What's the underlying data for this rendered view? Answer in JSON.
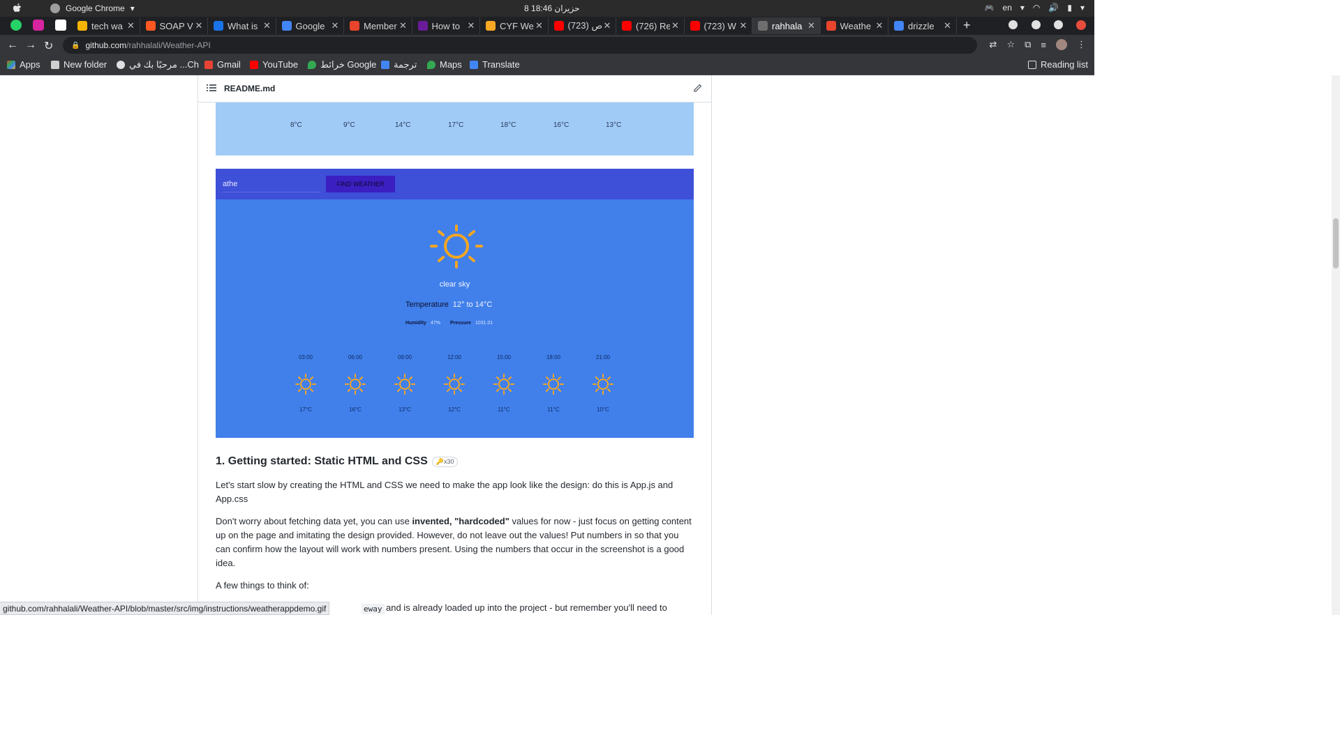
{
  "os_bar": {
    "app_name": "Google Chrome",
    "clock": "8 حزيران 18:46",
    "language": "en"
  },
  "tabs": [
    {
      "label": "tech wa",
      "favicon_color": "#f4b400"
    },
    {
      "label": "SOAP V",
      "favicon_color": "#ff5722"
    },
    {
      "label": "What is",
      "favicon_color": "#1a73e8"
    },
    {
      "label": "Google",
      "favicon_color": "#4285f4"
    },
    {
      "label": "Member",
      "favicon_color": "#e8452c"
    },
    {
      "label": "How to",
      "favicon_color": "#6a1b9a"
    },
    {
      "label": "CYF We",
      "favicon_color": "#f9a825"
    },
    {
      "label": "(723) اص",
      "favicon_color": "#ff0000"
    },
    {
      "label": "(726) Re",
      "favicon_color": "#ff0000"
    },
    {
      "label": "(723) W",
      "favicon_color": "#ff0000"
    },
    {
      "label": "rahhala",
      "favicon_color": "#6e6e6e"
    },
    {
      "label": "Weathe",
      "favicon_color": "#e8452c"
    },
    {
      "label": "drizzle",
      "favicon_color": "#4285f4"
    }
  ],
  "address_bar": {
    "host": "github.com",
    "path": "/rahhalali/Weather-API"
  },
  "bookmarks": [
    {
      "label": "Apps"
    },
    {
      "label": "New folder"
    },
    {
      "label": "مرحبًا بك في ...Ch"
    },
    {
      "label": "Gmail"
    },
    {
      "label": "YouTube"
    },
    {
      "label": "خرائط Google"
    },
    {
      "label": "ترجمة"
    },
    {
      "label": "Maps"
    },
    {
      "label": "Translate"
    }
  ],
  "reading_list": "Reading list",
  "readme": {
    "filename": "README.md"
  },
  "gif_top": {
    "temps": [
      "8°C",
      "9°C",
      "14°C",
      "17°C",
      "18°C",
      "16°C",
      "13°C"
    ]
  },
  "weather_app": {
    "search_value": "athe",
    "find_button": "FIND WEATHER",
    "description": "clear sky",
    "temperature_label": "Temperature",
    "temperature_value": "12° to 14°C",
    "humidity_label": "Humidity",
    "humidity_value": "47%",
    "pressure_label": "Pressure",
    "pressure_value": "1031.01",
    "hours": [
      "03:00",
      "06:00",
      "09:00",
      "12:00",
      "15:00",
      "18:00",
      "21:00"
    ],
    "hour_temps": [
      "17°C",
      "16°C",
      "13°C",
      "12°C",
      "11°C",
      "11°C",
      "10°C"
    ],
    "sun_color": "#f5a623"
  },
  "section": {
    "heading": "1. Getting started: Static HTML and CSS",
    "badge": "🔑x30",
    "p1": "Let's start slow by creating the HTML and CSS we need to make the app look like the design: do this is App.js and App.css",
    "p2_a": "Don't worry about fetching data yet, you can use ",
    "p2_bold": "invented, \"hardcoded\"",
    "p2_b": " values for now - just focus on getting content up on the page and imitating the design provided. However, do not leave out the values! Put numbers in so that you can confirm how the layout will work with numbers present. Using the numbers that occur in the screenshot is a good idea.",
    "p3": "A few things to think of:",
    "p4_code": "eway",
    "p4_tail": "and is already loaded up into the project - but remember you'll need to"
  },
  "status_url": "github.com/rahhalali/Weather-API/blob/master/src/img/instructions/weatherappdemo.gif"
}
